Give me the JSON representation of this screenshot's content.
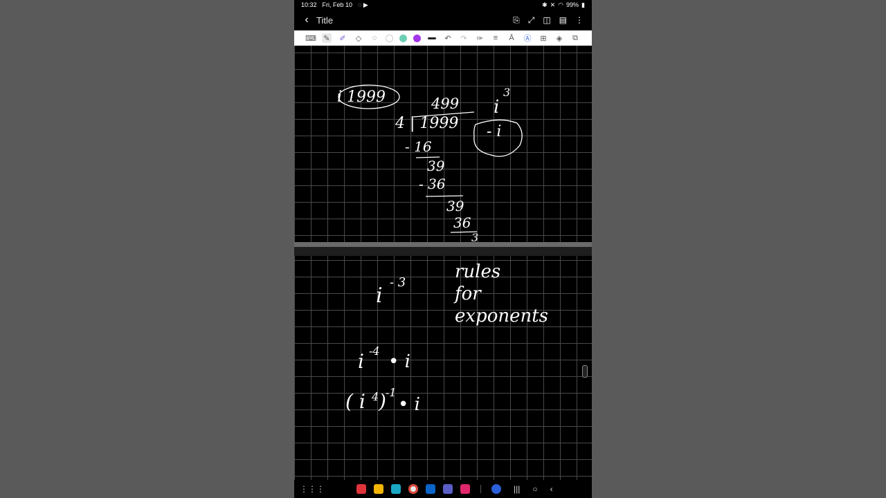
{
  "status": {
    "time": "10:32",
    "date": "Fri, Feb 10",
    "battery": "99%"
  },
  "note": {
    "title": "Title"
  },
  "toolbar": {
    "colors": [
      "#ffffff",
      "#6ccfb6",
      "#a236e8",
      "#222222"
    ]
  },
  "page1": {
    "expr_top": "i 1999",
    "quotient": "499",
    "dividend": "4 | 1999",
    "step1": "- 16",
    "r1": "39",
    "step2": "- 36",
    "r2": "39",
    "step3": "36",
    "r3": "3",
    "power": "i",
    "exp": "3",
    "result": "- i"
  },
  "page2": {
    "expr1_base": "i",
    "expr1_exp": "- 3",
    "notes": [
      "rules",
      "for",
      "exponents"
    ],
    "expr2": "i",
    "expr2_exp": "-4",
    "expr2_tail": "• i",
    "expr3": "( i",
    "expr3_inner_exp": "4",
    "expr3_close": ")",
    "expr3_exp": "-1",
    "expr3_tail": "• i"
  }
}
